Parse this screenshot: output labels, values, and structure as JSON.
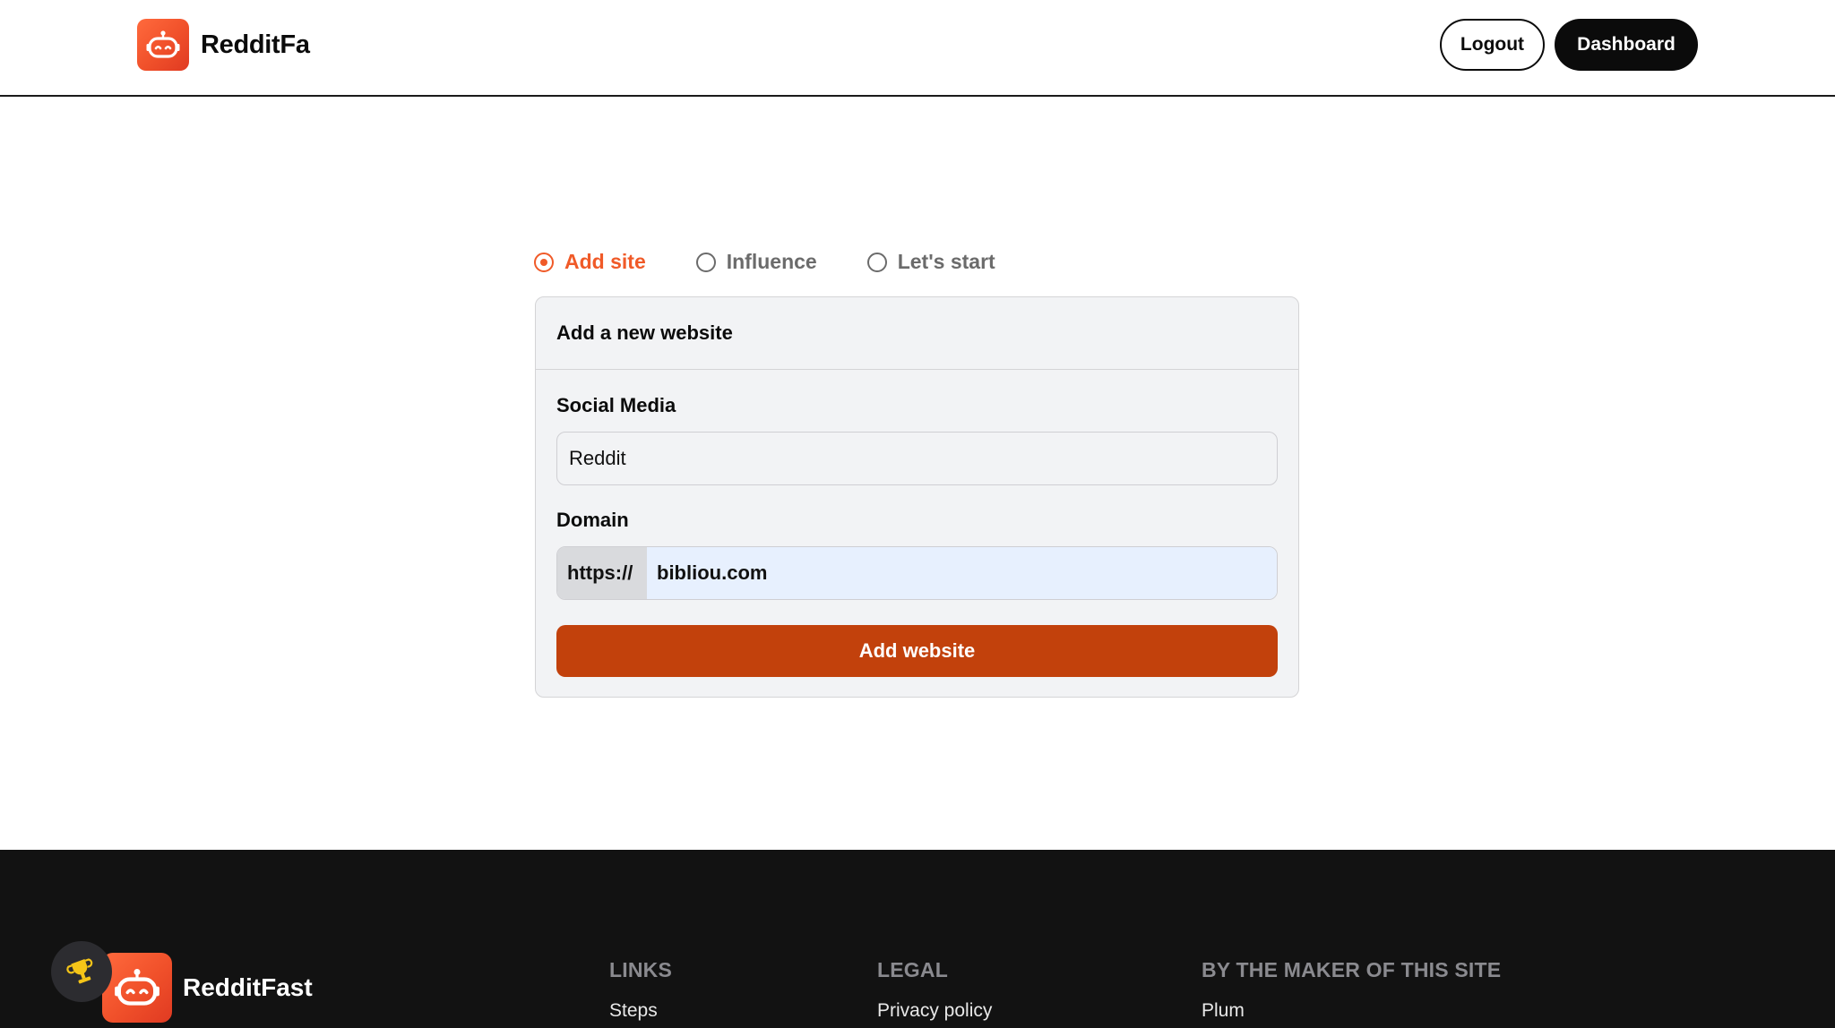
{
  "header": {
    "brand_name": "RedditFa",
    "logout_label": "Logout",
    "dashboard_label": "Dashboard"
  },
  "steps": [
    {
      "label": "Add site",
      "active": true
    },
    {
      "label": "Influence",
      "active": false
    },
    {
      "label": "Let's start",
      "active": false
    }
  ],
  "card": {
    "title": "Add a new website",
    "social_media_label": "Social Media",
    "social_media_value": "Reddit",
    "domain_label": "Domain",
    "domain_prefix": "https://",
    "domain_value": "bibliou.com",
    "submit_label": "Add website"
  },
  "footer": {
    "brand_name": "RedditFast",
    "columns": [
      {
        "heading": "LINKS",
        "links": [
          "Steps"
        ]
      },
      {
        "heading": "LEGAL",
        "links": [
          "Privacy policy"
        ]
      },
      {
        "heading": "BY THE MAKER OF THIS SITE",
        "links": [
          "Plum"
        ]
      }
    ]
  },
  "colors": {
    "accent": "#f05a28",
    "button_primary": "#c2410c",
    "header_dark": "#0b0b0b",
    "footer_bg": "#121212"
  },
  "icons": {
    "brand_logo": "robot-icon",
    "badge": "trophy-icon"
  }
}
